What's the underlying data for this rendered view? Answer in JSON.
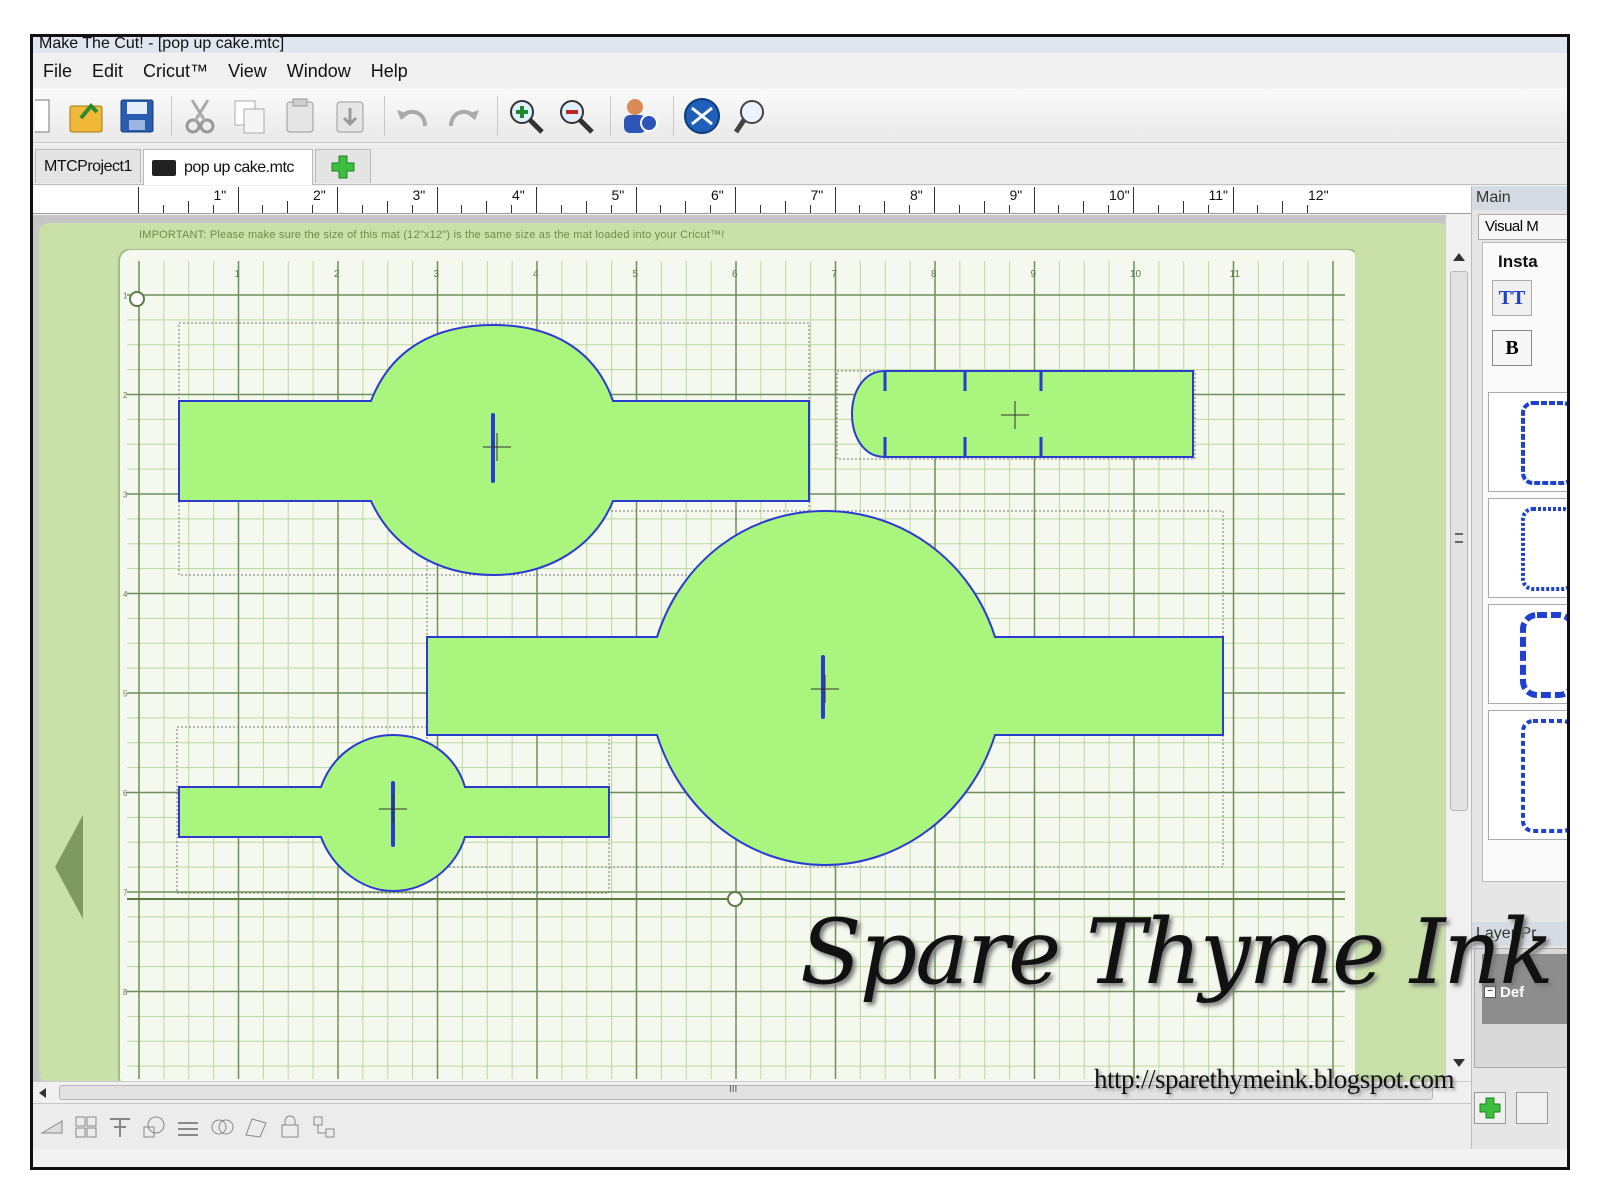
{
  "window": {
    "title": "Make The Cut! - [pop up cake.mtc]"
  },
  "menu": [
    "File",
    "Edit",
    "Cricut™",
    "View",
    "Window",
    "Help"
  ],
  "toolbar": {
    "icons": [
      "new-file-icon",
      "open-folder-icon",
      "save-icon",
      "cut-icon",
      "copy-icon",
      "paste-icon",
      "paste-special-icon",
      "undo-icon",
      "redo-icon",
      "zoom-in-icon",
      "zoom-out-icon",
      "user-help-icon",
      "cut-with-cricut-icon",
      "preview-icon"
    ]
  },
  "tabs": {
    "project": "MTCProject1",
    "file": "pop up cake.mtc",
    "add": "+"
  },
  "ruler": {
    "labels": [
      "1\"",
      "2\"",
      "3\"",
      "4\"",
      "5\"",
      "6\"",
      "7\"",
      "8\"",
      "9\"",
      "10\"",
      "11\"",
      "12\""
    ]
  },
  "mat": {
    "note": "IMPORTANT: Please make sure the size of this mat (12\"x12\") is the same size as the mat loaded into your Cricut™!",
    "top_numbers": [
      "1",
      "2",
      "3",
      "4",
      "5",
      "6",
      "7",
      "8",
      "9",
      "10",
      "11"
    ],
    "side_numbers": [
      "1",
      "2",
      "3",
      "4",
      "5",
      "6",
      "7",
      "8"
    ],
    "shape_fill": "#a9f57d",
    "shape_stroke": "#2b3bd0",
    "mat_color": "#c9e1a8"
  },
  "right_panel": {
    "main_header": "Main",
    "visual_tab": "Visual M",
    "insta_label": "Insta",
    "bold_button": "B",
    "layer_header": "Layer Pr",
    "default_label": "Def"
  },
  "scrollbar": {
    "grip": "III"
  },
  "watermark": {
    "signature": "Spare Thyme Ink",
    "url": "http://sparethymeink.blogspot.com"
  },
  "colors": {
    "accent": "#7e9a63",
    "grid": "#6f8f5a"
  }
}
